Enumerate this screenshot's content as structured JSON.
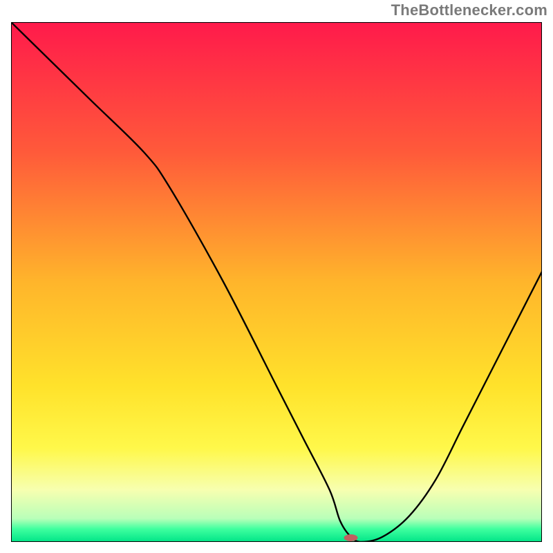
{
  "attribution": "TheBottlenecker.com",
  "chart_data": {
    "type": "line",
    "title": "",
    "xlabel": "",
    "ylabel": "",
    "xlim": [
      0,
      100
    ],
    "ylim": [
      0,
      100
    ],
    "x": [
      0,
      5,
      15,
      25,
      30,
      40,
      50,
      55,
      60,
      62,
      64,
      66,
      70,
      75,
      80,
      85,
      90,
      95,
      100
    ],
    "values": [
      100,
      95,
      85,
      75,
      68,
      50,
      30,
      20,
      10,
      4,
      1,
      0,
      1,
      5,
      12,
      22,
      32,
      42,
      52
    ],
    "marker": {
      "x": 64,
      "y": 0,
      "color": "#c06060",
      "rx": 10,
      "ry": 5
    },
    "gradient_stops": [
      {
        "offset": 0.0,
        "color": "#ff1a4b"
      },
      {
        "offset": 0.25,
        "color": "#ff5a3a"
      },
      {
        "offset": 0.5,
        "color": "#ffb52b"
      },
      {
        "offset": 0.7,
        "color": "#ffe22b"
      },
      {
        "offset": 0.82,
        "color": "#fff84a"
      },
      {
        "offset": 0.9,
        "color": "#f7ffb0"
      },
      {
        "offset": 0.955,
        "color": "#b9ffb9"
      },
      {
        "offset": 0.975,
        "color": "#3fff9f"
      },
      {
        "offset": 1.0,
        "color": "#00e588"
      }
    ],
    "frame_color": "#000000",
    "line_color": "#000000",
    "line_width": 2.4
  }
}
